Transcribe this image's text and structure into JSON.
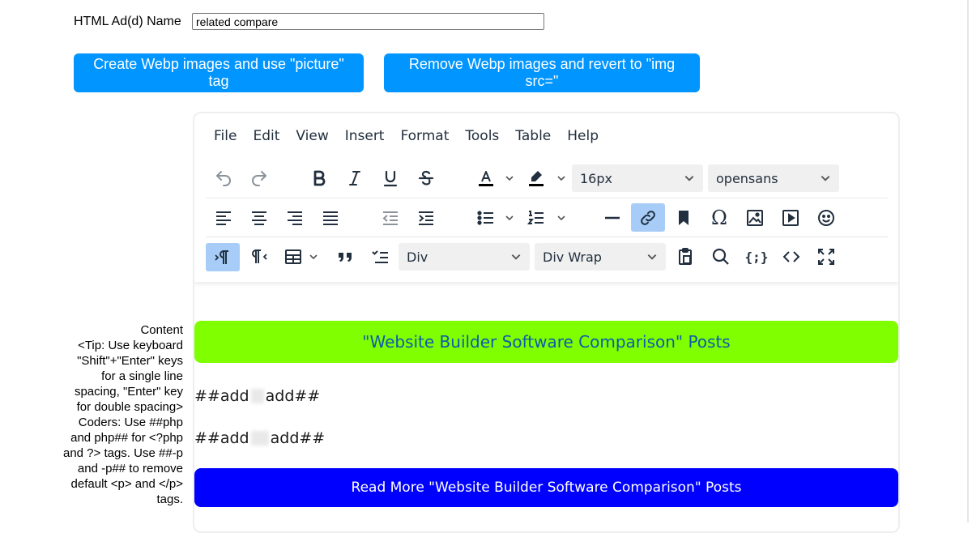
{
  "form": {
    "name_label": "HTML Ad(d) Name",
    "name_value": "related compare",
    "btn_webp_create": "Create Webp images and use \"picture\" tag",
    "btn_webp_remove": "Remove Webp images and revert to \"img src=\""
  },
  "content_label": {
    "title": "Content",
    "tip": "<Tip: Use keyboard \"Shift\"+\"Enter\" keys for a single line spacing, \"Enter\" key for double spacing> Coders: Use ##php and php## for <?php and ?> tags. Use ##-p and -p## to remove default <p> and </p> tags."
  },
  "editor": {
    "menu": [
      "File",
      "Edit",
      "View",
      "Insert",
      "Format",
      "Tools",
      "Table",
      "Help"
    ],
    "font_size": "16px",
    "font_family": "opensans",
    "block_format": "Div",
    "wrap_format": "Div Wrap",
    "content": {
      "heading": "\"Website Builder Software Comparison\" Posts",
      "add_line_1a": "##add",
      "add_line_1b": "add##",
      "add_line_2a": "##add",
      "add_line_2b": "add##",
      "read_more": "Read More \"Website Builder Software Comparison\" Posts"
    }
  },
  "colors": {
    "button_blue": "#0095ff",
    "heading_green": "#80ff00",
    "read_more_blue": "#0000ff",
    "active_tool": "#a6ccf7"
  },
  "icons": [
    "undo-icon",
    "redo-icon",
    "bold-icon",
    "italic-icon",
    "underline-icon",
    "strikethrough-icon",
    "text-color-icon",
    "highlight-color-icon",
    "align-left-icon",
    "align-center-icon",
    "align-right-icon",
    "align-justify-icon",
    "outdent-icon",
    "indent-icon",
    "bullet-list-icon",
    "numbered-list-icon",
    "horizontal-rule-icon",
    "link-icon",
    "bookmark-icon",
    "omega-icon",
    "image-icon",
    "media-icon",
    "emoji-icon",
    "ltr-icon",
    "rtl-icon",
    "table-icon",
    "blockquote-icon",
    "checklist-icon",
    "paste-icon",
    "search-icon",
    "code-sample-icon",
    "source-code-icon",
    "fullscreen-icon"
  ]
}
